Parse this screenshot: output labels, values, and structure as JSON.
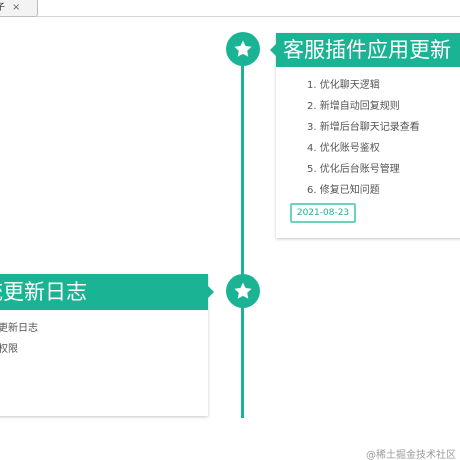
{
  "browser": {
    "tab_label": "子",
    "tab_close": "×"
  },
  "timeline": {
    "entries": [
      {
        "title": "客服插件应用更新",
        "items": [
          "1. 优化聊天逻辑",
          "2. 新增自动回复规则",
          "3. 新增后台聊天记录查看",
          "4. 优化账号鉴权",
          "5. 优化后台账号管理",
          "6. 修复已知问题"
        ],
        "date": "2021-08-23"
      },
      {
        "title": "统更新日志",
        "items": [
          "更新日志",
          "权限"
        ]
      }
    ]
  },
  "watermark": "@稀土掘金技术社区",
  "colors": {
    "accent": "#1ab394",
    "badge_border": "#6ad3bd"
  },
  "icons": {
    "timeline_node": "star-icon"
  }
}
